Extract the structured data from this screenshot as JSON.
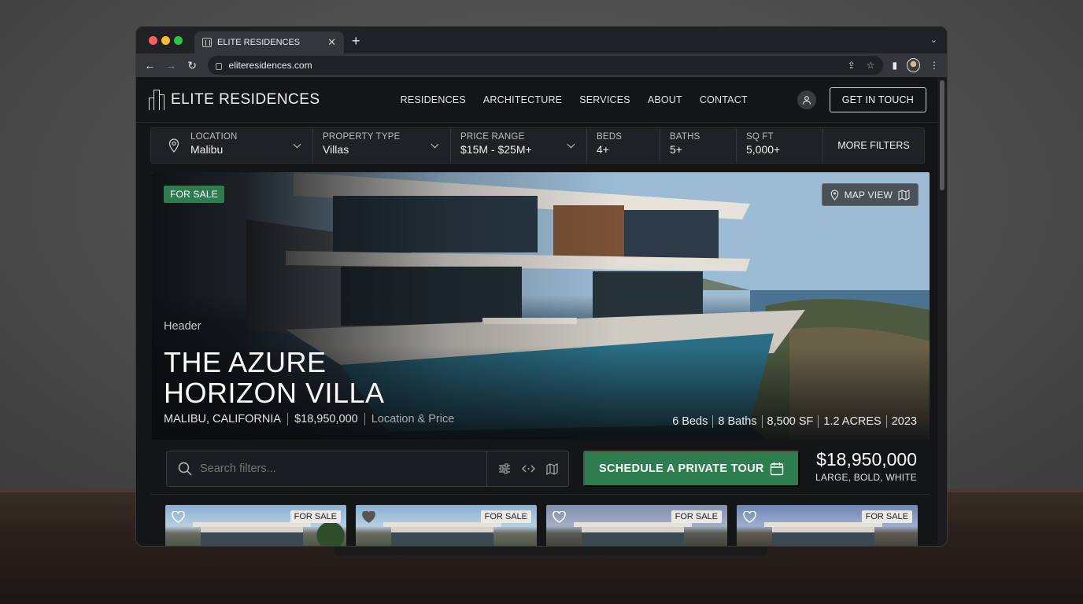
{
  "browser": {
    "tab_title": "ELITE RESIDENCES",
    "url": "eliteresidences.com"
  },
  "site": {
    "logo_text": "ELITE RESIDENCES",
    "nav": [
      "RESIDENCES",
      "ARCHITECTURE",
      "SERVICES",
      "ABOUT",
      "CONTACT"
    ],
    "cta_label": "GET IN TOUCH"
  },
  "filters": {
    "location": {
      "label": "LOCATION",
      "value": "Malibu"
    },
    "property_type": {
      "label": "PROPERTY TYPE",
      "value": "Villas"
    },
    "price_range": {
      "label": "PRICE RANGE",
      "value": "$15M - $25M+"
    },
    "beds": {
      "label": "BEDS",
      "value": "4+"
    },
    "baths": {
      "label": "BATHS",
      "value": "5+"
    },
    "sqft": {
      "label": "SQ FT",
      "value": "5,000+"
    },
    "more_label": "MORE FILTERS"
  },
  "hero": {
    "badge": "FOR SALE",
    "map_view_label": "MAP VIEW",
    "section_label": "Header",
    "title_line1": "THE AZURE",
    "title_line2": "HORIZON VILLA",
    "location": "MALIBU, CALIFORNIA",
    "price": "$18,950,000",
    "location_price_note": "Location & Price",
    "specs": [
      "6 Beds",
      "8 Baths",
      "8,500 SF",
      "1.2 ACRES",
      "2023"
    ]
  },
  "actions": {
    "search_placeholder": "Search filters...",
    "tour_label": "SCHEDULE A PRIVATE TOUR",
    "price": "$18,950,000",
    "price_note": "LARGE, BOLD, WHITE"
  },
  "cards": [
    {
      "tag": "FOR SALE"
    },
    {
      "tag": "FOR SALE"
    },
    {
      "tag": "FOR SALE"
    },
    {
      "tag": "FOR SALE"
    }
  ],
  "colors": {
    "accent_green": "#2e7d4f",
    "page_bg": "#141517",
    "browser_chrome": "#202124"
  }
}
